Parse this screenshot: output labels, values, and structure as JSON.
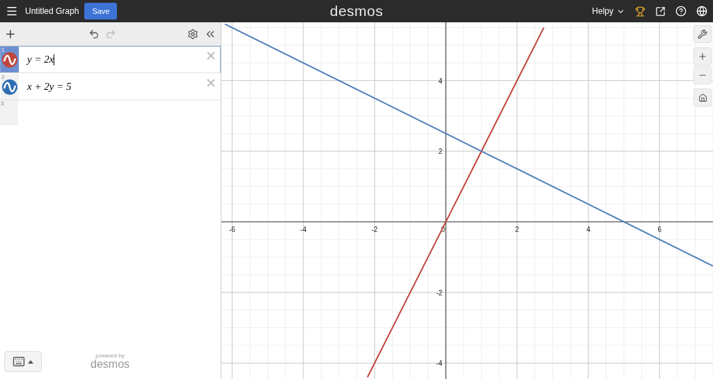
{
  "header": {
    "title": "Untitled Graph",
    "save_label": "Save",
    "logo": "desmos",
    "user": "Helpy"
  },
  "expressions": [
    {
      "index": "1",
      "latex": "y = 2x",
      "color": "#c0453b",
      "selected": true
    },
    {
      "index": "2",
      "latex": "x + 2y = 5",
      "color": "#2f6db3",
      "selected": false
    },
    {
      "index": "3"
    }
  ],
  "footer": {
    "powered": "powered by",
    "brand": "desmos"
  },
  "graph": {
    "chart_data": {
      "type": "line",
      "grid": true,
      "x": [
        -6.2,
        -2.2,
        0,
        1,
        2.75,
        7.5
      ],
      "series": [
        {
          "color": "#c0453b",
          "values": [
            null,
            -4.4,
            0,
            2,
            5.5,
            null
          ]
        },
        {
          "color": "#4f7fb8",
          "values": [
            5.6,
            3.6,
            2.5,
            2,
            1.125,
            -1.25
          ]
        }
      ],
      "xlim": [
        -6.3,
        7.5
      ],
      "ylim": [
        -4.45,
        5.65
      ],
      "xticks": [
        -6,
        -4,
        -2,
        0,
        2,
        4,
        6
      ],
      "yticks": [
        -4,
        -2,
        2,
        4
      ]
    }
  }
}
